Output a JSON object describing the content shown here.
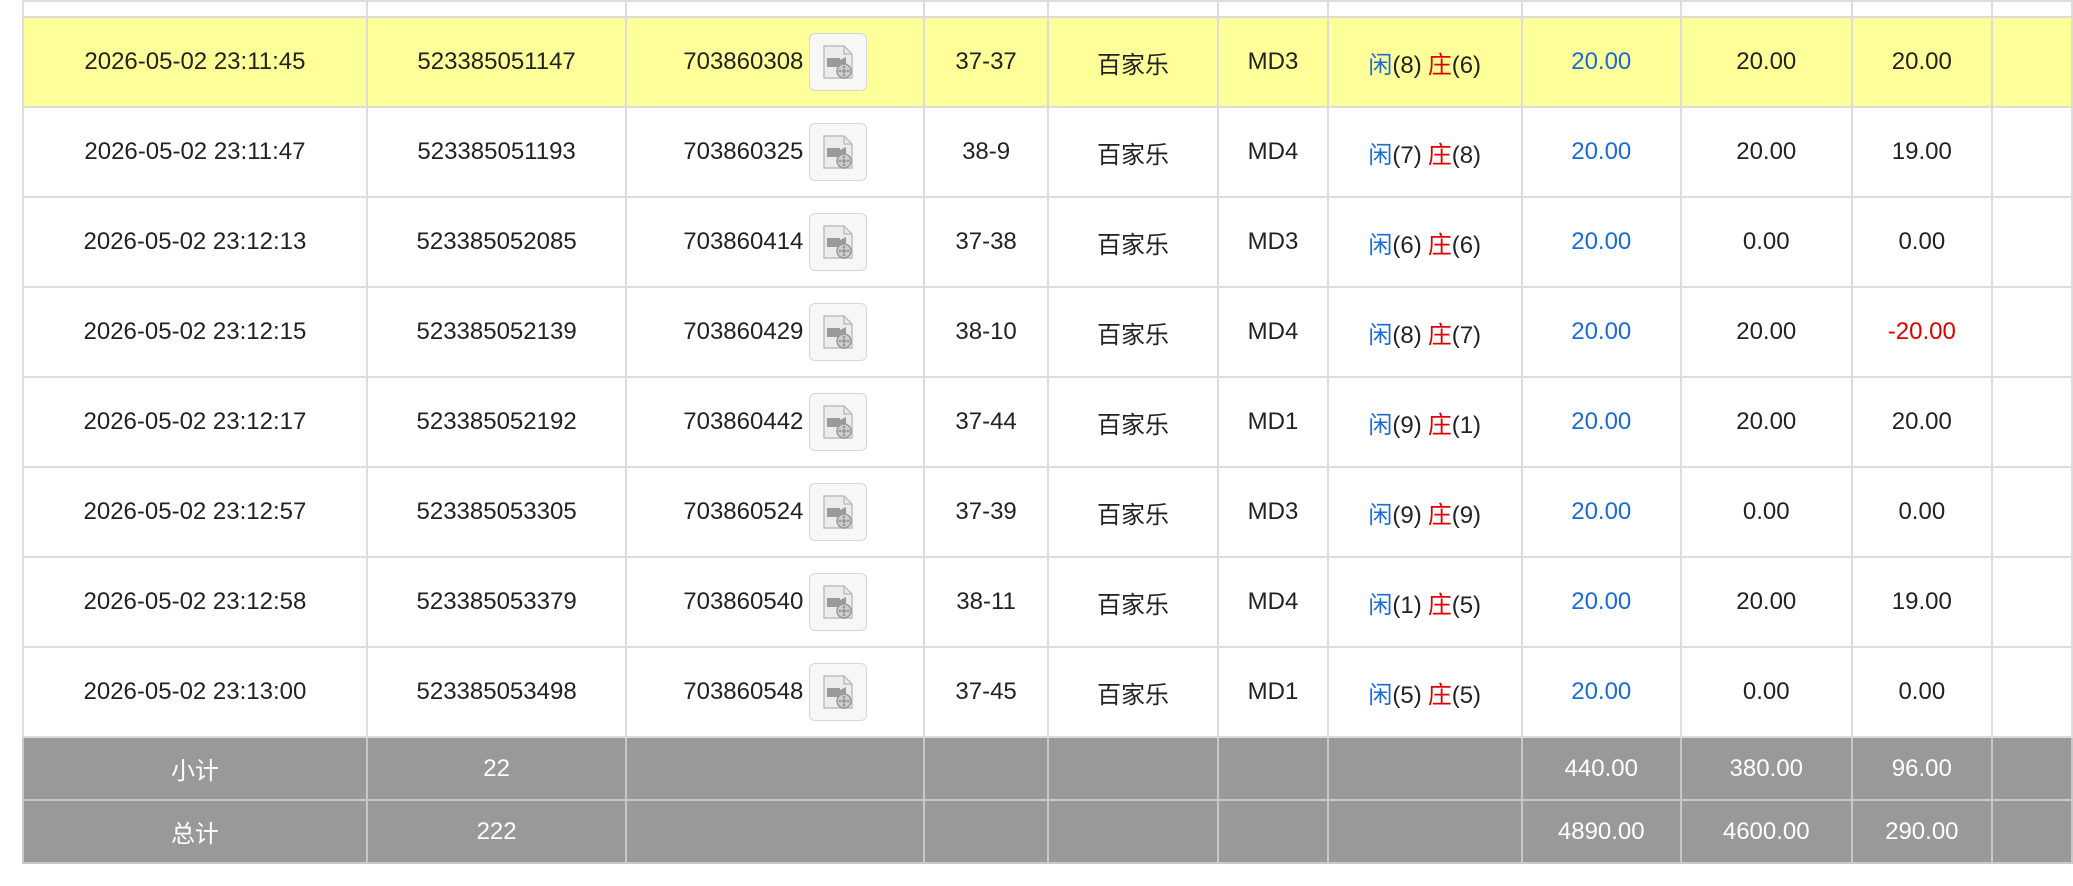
{
  "rows": [
    {
      "time": "2026-05-02 23:11:45",
      "bet_no": "523385051147",
      "game_no": "703860308",
      "shoe": "37-37",
      "game": "百家乐",
      "table": "MD3",
      "player_label": "闲",
      "player_val": "(8)",
      "banker_label": "庄",
      "banker_val": "(6)",
      "bet": "20.00",
      "valid": "20.00",
      "win": "20.00",
      "highlight": true,
      "win_negative": false
    },
    {
      "time": "2026-05-02 23:11:47",
      "bet_no": "523385051193",
      "game_no": "703860325",
      "shoe": "38-9",
      "game": "百家乐",
      "table": "MD4",
      "player_label": "闲",
      "player_val": "(7)",
      "banker_label": "庄",
      "banker_val": "(8)",
      "bet": "20.00",
      "valid": "20.00",
      "win": "19.00",
      "highlight": false,
      "win_negative": false
    },
    {
      "time": "2026-05-02 23:12:13",
      "bet_no": "523385052085",
      "game_no": "703860414",
      "shoe": "37-38",
      "game": "百家乐",
      "table": "MD3",
      "player_label": "闲",
      "player_val": "(6)",
      "banker_label": "庄",
      "banker_val": "(6)",
      "bet": "20.00",
      "valid": "0.00",
      "win": "0.00",
      "highlight": false,
      "win_negative": false
    },
    {
      "time": "2026-05-02 23:12:15",
      "bet_no": "523385052139",
      "game_no": "703860429",
      "shoe": "38-10",
      "game": "百家乐",
      "table": "MD4",
      "player_label": "闲",
      "player_val": "(8)",
      "banker_label": "庄",
      "banker_val": "(7)",
      "bet": "20.00",
      "valid": "20.00",
      "win": "-20.00",
      "highlight": false,
      "win_negative": true
    },
    {
      "time": "2026-05-02 23:12:17",
      "bet_no": "523385052192",
      "game_no": "703860442",
      "shoe": "37-44",
      "game": "百家乐",
      "table": "MD1",
      "player_label": "闲",
      "player_val": "(9)",
      "banker_label": "庄",
      "banker_val": "(1)",
      "bet": "20.00",
      "valid": "20.00",
      "win": "20.00",
      "highlight": false,
      "win_negative": false
    },
    {
      "time": "2026-05-02 23:12:57",
      "bet_no": "523385053305",
      "game_no": "703860524",
      "shoe": "37-39",
      "game": "百家乐",
      "table": "MD3",
      "player_label": "闲",
      "player_val": "(9)",
      "banker_label": "庄",
      "banker_val": "(9)",
      "bet": "20.00",
      "valid": "0.00",
      "win": "0.00",
      "highlight": false,
      "win_negative": false
    },
    {
      "time": "2026-05-02 23:12:58",
      "bet_no": "523385053379",
      "game_no": "703860540",
      "shoe": "38-11",
      "game": "百家乐",
      "table": "MD4",
      "player_label": "闲",
      "player_val": "(1)",
      "banker_label": "庄",
      "banker_val": "(5)",
      "bet": "20.00",
      "valid": "20.00",
      "win": "19.00",
      "highlight": false,
      "win_negative": false
    },
    {
      "time": "2026-05-02 23:13:00",
      "bet_no": "523385053498",
      "game_no": "703860548",
      "shoe": "37-45",
      "game": "百家乐",
      "table": "MD1",
      "player_label": "闲",
      "player_val": "(5)",
      "banker_label": "庄",
      "banker_val": "(5)",
      "bet": "20.00",
      "valid": "0.00",
      "win": "0.00",
      "highlight": false,
      "win_negative": false
    }
  ],
  "subtotal": {
    "label": "小计",
    "count": "22",
    "bet": "440.00",
    "valid": "380.00",
    "win": "96.00"
  },
  "total": {
    "label": "总计",
    "count": "222",
    "bet": "4890.00",
    "valid": "4600.00",
    "win": "290.00"
  },
  "colors": {
    "highlight_row": "#ffff99",
    "player": "#1a6bd6",
    "banker": "#e00000",
    "summary_bg": "#999999",
    "negative": "#e00000"
  },
  "icons": {
    "replay_button": "video-replay-icon"
  }
}
